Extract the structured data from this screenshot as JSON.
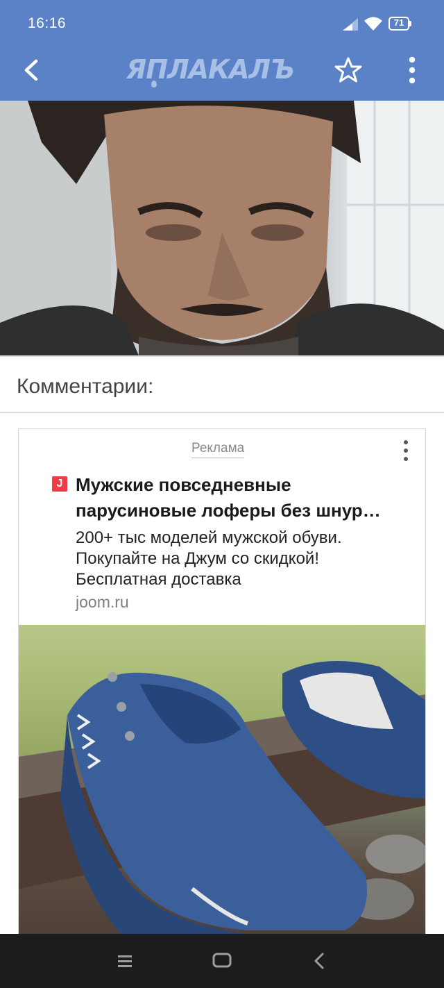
{
  "status_bar": {
    "time": "16:16",
    "battery": "71",
    "icons": [
      "signal-icon",
      "wifi-icon",
      "battery-icon"
    ]
  },
  "app_bar": {
    "logo_text": "ЯПЛАКАЛЪ",
    "back_icon": "chevron-left-icon",
    "favorite_icon": "star-outline-icon",
    "menu_icon": "more-vertical-icon",
    "background_color": "#5b82c7",
    "logo_color": "#a9c0e6"
  },
  "post": {
    "image": "photo-of-bearded-man"
  },
  "comments": {
    "title": "Комментарии:"
  },
  "ad": {
    "label": "Реклама",
    "favicon_letter": "J",
    "title_lines": [
      "Мужские повседневные",
      "парусиновые лоферы без шнур…"
    ],
    "description_lines": [
      "200+ тыс моделей мужской обуви.",
      "Покупайте на Джум со скидкой!",
      "Бесплатная доставка"
    ],
    "domain": "joom.ru",
    "image": "photo-of-blue-canvas-loafers",
    "favicon_color": "#ee3b4a"
  },
  "nav_bar": {
    "icons": [
      "recent-apps-icon",
      "home-icon",
      "back-icon"
    ]
  }
}
